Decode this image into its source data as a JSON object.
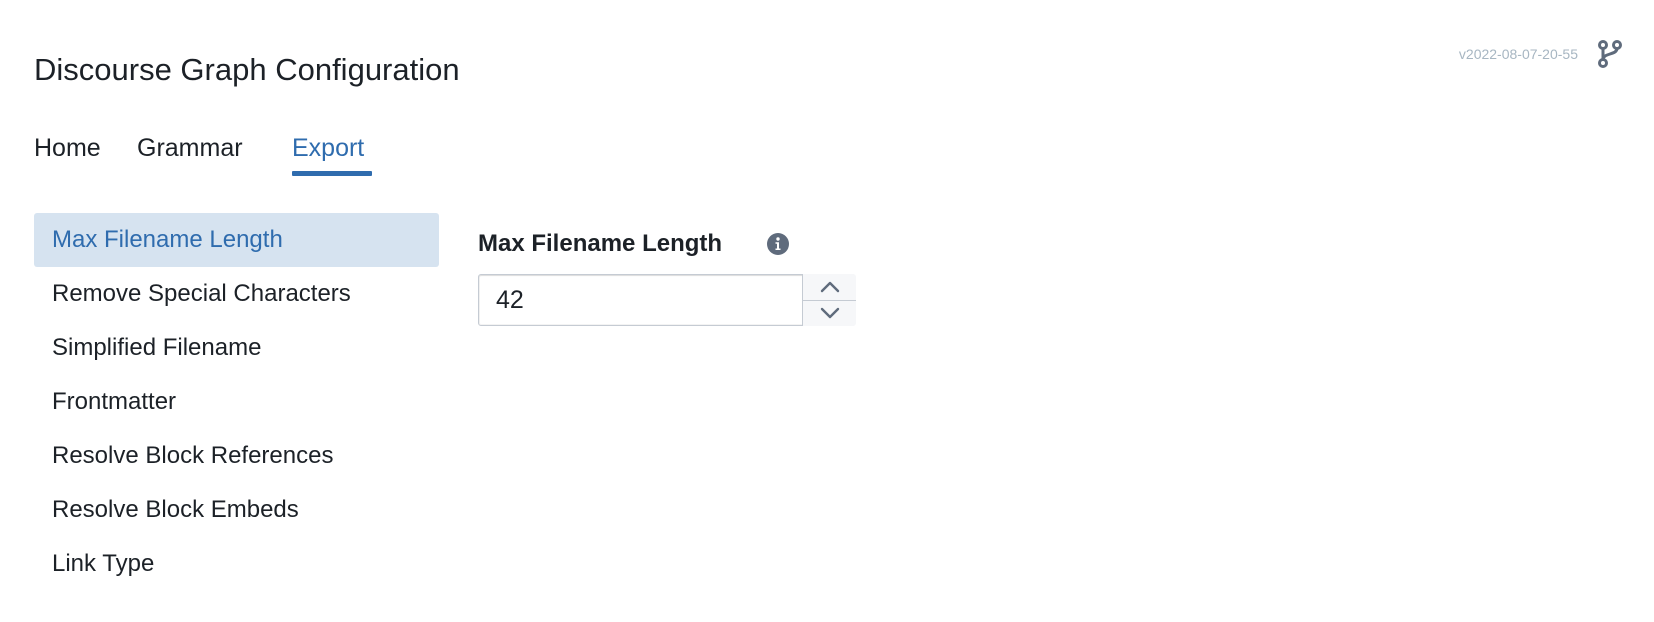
{
  "header": {
    "title": "Discourse Graph Configuration",
    "version": "v2022-08-07-20-55",
    "branch_icon": "git-branch-icon"
  },
  "tabs": [
    {
      "label": "Home",
      "active": false
    },
    {
      "label": "Grammar",
      "active": false
    },
    {
      "label": "Export",
      "active": true
    }
  ],
  "sidebar": {
    "items": [
      {
        "label": "Max Filename Length",
        "active": true
      },
      {
        "label": "Remove Special Characters",
        "active": false
      },
      {
        "label": "Simplified Filename",
        "active": false
      },
      {
        "label": "Frontmatter",
        "active": false
      },
      {
        "label": "Resolve Block References",
        "active": false
      },
      {
        "label": "Resolve Block Embeds",
        "active": false
      },
      {
        "label": "Link Type",
        "active": false
      }
    ]
  },
  "panel": {
    "label": "Max Filename Length",
    "info_icon": "info-icon",
    "value": "42",
    "increment_icon": "chevron-up-icon",
    "decrement_icon": "chevron-down-icon"
  },
  "colors": {
    "accent": "#2f6cae",
    "active_bg": "#d6e3f0",
    "text": "#1c2127",
    "muted": "#a7b6c2"
  }
}
